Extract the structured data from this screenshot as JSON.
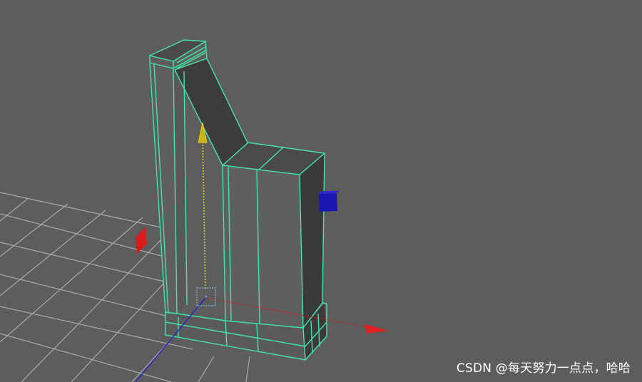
{
  "watermark": {
    "text": "CSDN @每天努力一点点，哈哈"
  },
  "colors": {
    "background": "#5d5d5d",
    "grid_line": "#a8a8a8",
    "mesh_wire": "#42e6a7",
    "face_front": "#5f5f5f",
    "face_dark": "#3a3a3a",
    "face_side": "#474747",
    "manipulator_x": "#d81b1b",
    "manipulator_y": "#e6cc1e",
    "manipulator_z": "#1a1ab8",
    "manipulator_center": "#78b6e6"
  },
  "icons": {
    "manipulator": "move-tool-manipulator",
    "handle_x": "x-axis-scale-handle",
    "handle_y": "y-axis-arrow",
    "handle_z": "z-axis-scale-handle",
    "pivot": "pivot-point"
  }
}
